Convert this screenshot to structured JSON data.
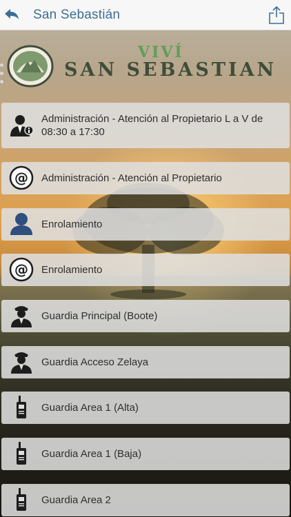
{
  "header": {
    "title": "San Sebastián"
  },
  "logo": {
    "tagline": "VIVÍ",
    "name": "SAN SEBASTIAN"
  },
  "contacts": [
    {
      "label": "Administración - Atención al Propietario L a V de 08:30 a 17:30",
      "icon": "person-info-icon"
    },
    {
      "label": "Administración - Atención al Propietario",
      "icon": "at-sign-icon"
    },
    {
      "label": "Enrolamiento",
      "icon": "person-icon"
    },
    {
      "label": "Enrolamiento",
      "icon": "at-sign-icon"
    },
    {
      "label": "Guardia Principal (Boote)",
      "icon": "guard-icon"
    },
    {
      "label": "Guardia Acceso Zelaya",
      "icon": "guard-icon"
    },
    {
      "label": "Guardia Area 1 (Alta)",
      "icon": "radio-icon"
    },
    {
      "label": "Guardia Area 1 (Baja)",
      "icon": "radio-icon"
    },
    {
      "label": "Guardia Area 2",
      "icon": "radio-icon"
    }
  ],
  "colors": {
    "title": "#3d6e92",
    "logo_green": "#5f9e57",
    "logo_dark": "#3f4d3a",
    "icon_blue": "#2f4f7f"
  }
}
